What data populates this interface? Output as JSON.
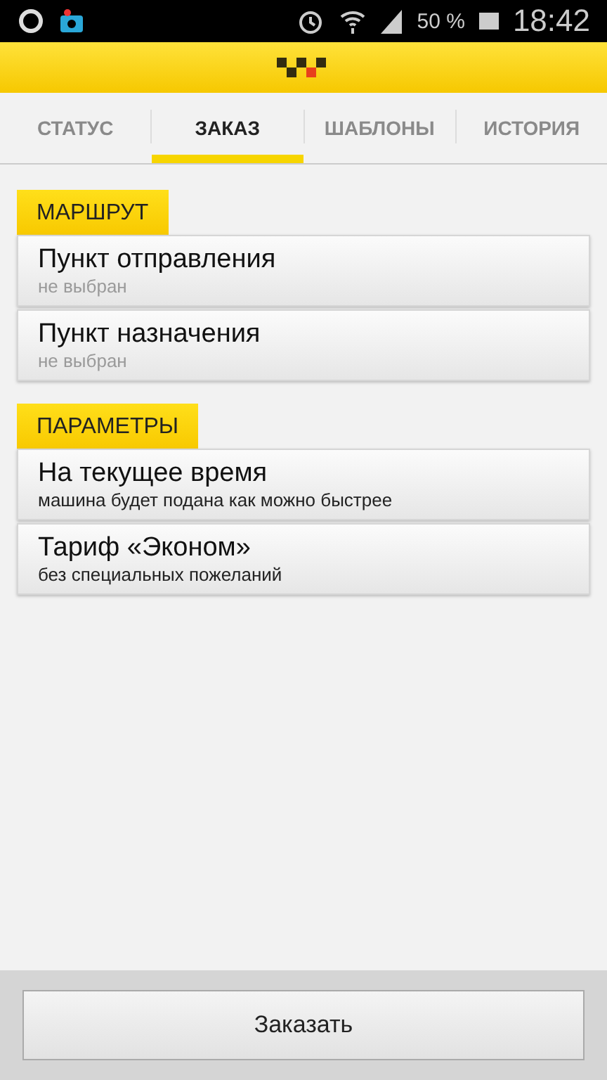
{
  "status_bar": {
    "battery": "50 %",
    "time": "18:42"
  },
  "tabs": [
    {
      "label": "СТАТУС",
      "selected": false
    },
    {
      "label": "ЗАКАЗ",
      "selected": true
    },
    {
      "label": "ШАБЛОНЫ",
      "selected": false
    },
    {
      "label": "ИСТОРИЯ",
      "selected": false
    }
  ],
  "sections": [
    {
      "title": "МАРШРУТ",
      "items": [
        {
          "title": "Пункт отправления",
          "subtitle": "не выбран",
          "muted": true
        },
        {
          "title": "Пункт назначения",
          "subtitle": "не выбран",
          "muted": true
        }
      ]
    },
    {
      "title": "ПАРАМЕТРЫ",
      "items": [
        {
          "title": "На текущее время",
          "subtitle": "машина будет подана как можно быстрее",
          "muted": false
        },
        {
          "title": "Тариф «Эконом»",
          "subtitle": "без специальных пожеланий",
          "muted": false
        }
      ]
    }
  ],
  "order_button": "Заказать"
}
